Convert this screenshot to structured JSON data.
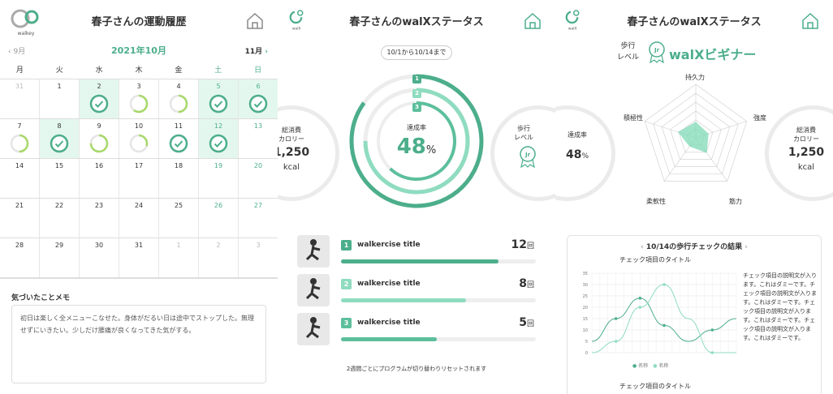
{
  "brand_color": "#4cae8b",
  "logo_text": "walkey",
  "logo_text2": "walX",
  "history": {
    "title": "春子さんの運動履歴",
    "prev_month": "9月",
    "current_month": "2021年10月",
    "next_month": "11月",
    "weekdays": [
      "月",
      "火",
      "水",
      "木",
      "金",
      "土",
      "日"
    ],
    "weeks": [
      [
        {
          "d": "31",
          "gray": true,
          "p": 0,
          "hl": false
        },
        {
          "d": "1",
          "p": 0,
          "hl": false
        },
        {
          "d": "2",
          "p": 1,
          "hl": true,
          "check": true
        },
        {
          "d": "3",
          "p": 0.6,
          "hl": false
        },
        {
          "d": "4",
          "p": 0.5,
          "hl": false
        },
        {
          "d": "5",
          "p": 1,
          "hl": true,
          "check": true
        },
        {
          "d": "6",
          "p": 1,
          "hl": true,
          "check": true
        }
      ],
      [
        {
          "d": "7",
          "p": 0.5,
          "hl": false
        },
        {
          "d": "8",
          "p": 1,
          "hl": true,
          "check": true
        },
        {
          "d": "9",
          "p": 0.75,
          "hl": false
        },
        {
          "d": "10",
          "p": 0.3,
          "hl": false
        },
        {
          "d": "11",
          "p": 1,
          "hl": false,
          "check": true
        },
        {
          "d": "12",
          "p": 1,
          "hl": true,
          "check": true
        },
        {
          "d": "13",
          "p": 0,
          "hl": false
        }
      ],
      [
        {
          "d": "14",
          "p": 0
        },
        {
          "d": "15",
          "p": 0
        },
        {
          "d": "16",
          "p": 0
        },
        {
          "d": "17",
          "p": 0
        },
        {
          "d": "18",
          "p": 0
        },
        {
          "d": "19",
          "p": 0
        },
        {
          "d": "20",
          "p": 0
        }
      ],
      [
        {
          "d": "21",
          "p": 0
        },
        {
          "d": "22",
          "p": 0
        },
        {
          "d": "23",
          "p": 0
        },
        {
          "d": "24",
          "p": 0
        },
        {
          "d": "25",
          "p": 0
        },
        {
          "d": "26",
          "p": 0
        },
        {
          "d": "27",
          "p": 0
        }
      ],
      [
        {
          "d": "28",
          "p": 0
        },
        {
          "d": "29",
          "p": 0
        },
        {
          "d": "30",
          "p": 0
        },
        {
          "d": "31",
          "p": 0
        },
        {
          "d": "1",
          "gray": true,
          "p": 0
        },
        {
          "d": "2",
          "gray": true,
          "p": 0
        },
        {
          "d": "3",
          "gray": true,
          "p": 0
        }
      ]
    ],
    "memo_title": "気づいたことメモ",
    "memo_text": "初日は楽しく全メニューこなせた。身体がだるい日は途中でストップした。無理せずにいきたい。少しだけ腰痛が良くなってきた気がする。"
  },
  "status": {
    "title": "春子さんのwalXステータス",
    "period": "10/1から10/14まで",
    "calorie_label": "総消費\nカロリー",
    "calorie_value": "1,250",
    "calorie_unit": "kcal",
    "rate_label": "達成率",
    "rate_value": "48",
    "rate_unit": "%",
    "level_label": "歩行\nレベル",
    "level_badge": "Jr",
    "ring_levels": [
      0.85,
      0.75,
      0.62
    ],
    "exercises": [
      {
        "num": "1",
        "title": "walkercise title",
        "count": "12",
        "unit": "回",
        "progress": 0.81,
        "color": "#4cae8b"
      },
      {
        "num": "2",
        "title": "walkercise title",
        "count": "8",
        "unit": "回",
        "progress": 0.64,
        "color": "#8fdcc0"
      },
      {
        "num": "3",
        "title": "walkercise title",
        "count": "5",
        "unit": "回",
        "progress": 0.49,
        "color": "#5cbf9c"
      }
    ],
    "footer": "2週間ごとにプログラムが切り替わりリセットされます"
  },
  "status2": {
    "title": "春子さんのwalXステータス",
    "level_label": "歩行\nレベル",
    "level_badge": "Jr",
    "level_name": "walXビギナー",
    "radar_axes": [
      "持久力",
      "強度",
      "筋力",
      "柔軟性",
      "積極性"
    ],
    "radar_values": [
      0.3,
      0.25,
      0.35,
      0.2,
      0.35
    ],
    "rate_label": "達成率",
    "rate_value": "48",
    "rate_unit": "%",
    "calorie_label": "総消費\nカロリー",
    "calorie_value": "1,250",
    "calorie_unit": "kcal",
    "check_title": "10/14の歩行チェックの結果",
    "check_item_title": "チェック項目のタイトル",
    "check_item_title2": "チェック項目のタイトル",
    "check_desc": "チェック項目の説明文が入ります。これはダミーです。チェック項目の説明文が入ります。これはダミーです。チェック項目の説明文が入ります。これはダミーです。チェック項目の説明文が入ります。これはダミーです。",
    "chart_data": {
      "type": "line",
      "ylim": [
        0,
        35
      ],
      "yticks": [
        0,
        5,
        10,
        15,
        20,
        25,
        30,
        35
      ],
      "series": [
        {
          "name": "名称",
          "color": "#4cae8b",
          "values": [
            5,
            15,
            24,
            12,
            5,
            10,
            15
          ]
        },
        {
          "name": "名称",
          "color": "#8fdcc0",
          "values": [
            0,
            5,
            20,
            30,
            15,
            0,
            0
          ]
        }
      ]
    }
  }
}
